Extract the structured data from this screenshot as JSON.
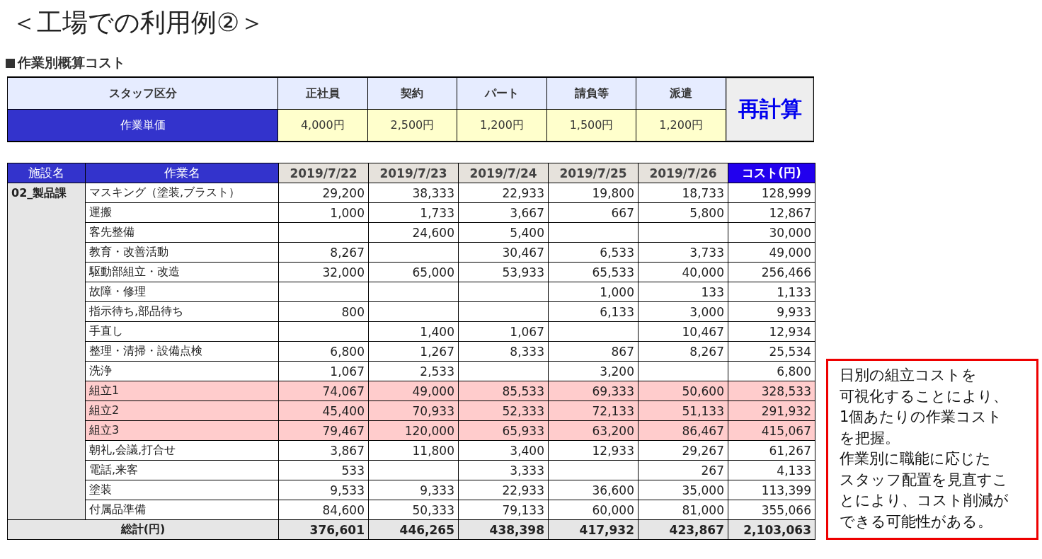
{
  "title": "＜工場での利用例②＞",
  "section_title": "作業別概算コスト",
  "rate_table": {
    "header_label": "スタッフ区分",
    "row_label": "作業単価",
    "staff": [
      {
        "name": "正社員",
        "rate": "4,000円"
      },
      {
        "name": "契約",
        "rate": "2,500円"
      },
      {
        "name": "パート",
        "rate": "1,200円"
      },
      {
        "name": "請負等",
        "rate": "1,500円"
      },
      {
        "name": "派遣",
        "rate": "1,200円"
      }
    ],
    "recalc_button": "再計算"
  },
  "cost_table": {
    "columns": [
      {
        "label": "施設名",
        "kind": "name"
      },
      {
        "label": "作業名",
        "kind": "name"
      },
      {
        "label": "2019/7/22",
        "kind": "date"
      },
      {
        "label": "2019/7/23",
        "kind": "date"
      },
      {
        "label": "2019/7/24",
        "kind": "date"
      },
      {
        "label": "2019/7/25",
        "kind": "date"
      },
      {
        "label": "2019/7/26",
        "kind": "date"
      },
      {
        "label": "コスト(円)",
        "kind": "total"
      }
    ],
    "facility": "02_製品課",
    "rows": [
      {
        "task": "マスキング（塗装,ブラスト）",
        "highlighted": false,
        "day_1": "29,200",
        "day_2": "38,333",
        "day_3": "22,933",
        "day_4": "19,800",
        "day_5": "18,733",
        "cost": "128,999"
      },
      {
        "task": "運搬",
        "highlighted": false,
        "day_1": "1,000",
        "day_2": "1,733",
        "day_3": "3,667",
        "day_4": "667",
        "day_5": "5,800",
        "cost": "12,867"
      },
      {
        "task": "客先整備",
        "highlighted": false,
        "day_2": "24,600",
        "day_3": "5,400",
        "cost": "30,000"
      },
      {
        "task": "教育・改善活動",
        "highlighted": false,
        "day_1": "8,267",
        "day_3": "30,467",
        "day_4": "6,533",
        "day_5": "3,733",
        "cost": "49,000"
      },
      {
        "task": "駆動部組立・改造",
        "highlighted": false,
        "day_1": "32,000",
        "day_2": "65,000",
        "day_3": "53,933",
        "day_4": "65,533",
        "day_5": "40,000",
        "cost": "256,466"
      },
      {
        "task": "故障・修理",
        "highlighted": false,
        "day_4": "1,000",
        "day_5": "133",
        "cost": "1,133"
      },
      {
        "task": "指示待ち,部品待ち",
        "highlighted": false,
        "day_1": "800",
        "day_4": "6,133",
        "day_5": "3,000",
        "cost": "9,933"
      },
      {
        "task": "手直し",
        "highlighted": false,
        "day_2": "1,400",
        "day_3": "1,067",
        "day_5": "10,467",
        "cost": "12,934"
      },
      {
        "task": "整理・清掃・設備点検",
        "highlighted": false,
        "day_1": "6,800",
        "day_2": "1,267",
        "day_3": "8,333",
        "day_4": "867",
        "day_5": "8,267",
        "cost": "25,534"
      },
      {
        "task": "洗浄",
        "highlighted": false,
        "day_1": "1,067",
        "day_2": "2,533",
        "day_4": "3,200",
        "cost": "6,800"
      },
      {
        "task": "組立1",
        "highlighted": true,
        "day_1": "74,067",
        "day_2": "49,000",
        "day_3": "85,533",
        "day_4": "69,333",
        "day_5": "50,600",
        "cost": "328,533"
      },
      {
        "task": "組立2",
        "highlighted": true,
        "day_1": "45,400",
        "day_2": "70,933",
        "day_3": "52,333",
        "day_4": "72,133",
        "day_5": "51,133",
        "cost": "291,932"
      },
      {
        "task": "組立3",
        "highlighted": true,
        "day_1": "79,467",
        "day_2": "120,000",
        "day_3": "65,933",
        "day_4": "63,200",
        "day_5": "86,467",
        "cost": "415,067"
      },
      {
        "task": "朝礼,会議,打合せ",
        "highlighted": false,
        "day_1": "3,867",
        "day_2": "11,800",
        "day_3": "3,400",
        "day_4": "12,933",
        "day_5": "29,267",
        "cost": "61,267"
      },
      {
        "task": "電話,来客",
        "highlighted": false,
        "day_1": "533",
        "day_3": "3,333",
        "day_5": "267",
        "cost": "4,133"
      },
      {
        "task": "塗装",
        "highlighted": false,
        "day_1": "9,533",
        "day_2": "9,333",
        "day_3": "22,933",
        "day_4": "36,600",
        "day_5": "35,000",
        "cost": "113,399"
      },
      {
        "task": "付属品準備",
        "highlighted": false,
        "day_1": "84,600",
        "day_2": "50,333",
        "day_3": "79,133",
        "day_4": "60,000",
        "day_5": "81,000",
        "cost": "355,066"
      }
    ],
    "total": {
      "label": "総計(円)",
      "values": [
        "376,601",
        "446,265",
        "438,398",
        "417,932",
        "423,867",
        "2,103,063"
      ]
    }
  },
  "note_lines": [
    "日別の組立コストを",
    "可視化することにより、",
    "1個あたりの作業コスト",
    "を把握。",
    "作業別に職能に応じた",
    "スタッフ配置を見直すこ",
    "とにより、コスト削減が",
    "できる可能性がある。"
  ]
}
